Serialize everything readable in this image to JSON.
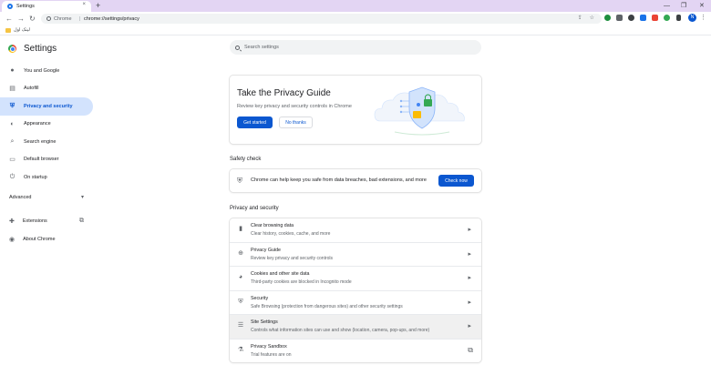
{
  "browser": {
    "tab_title": "Settings",
    "tab_close": "×",
    "new_tab": "+",
    "omnibox_site": "Chrome",
    "omnibox_url": "chrome://settings/privacy",
    "bookmark_folder": "لینک اول",
    "profile_initial": "N",
    "back": "←",
    "forward": "→",
    "reload": "↻",
    "menu": "⋮"
  },
  "sidebar": {
    "title": "Settings",
    "items": [
      {
        "label": "You and Google",
        "icon": "person-icon",
        "glyph": "👤"
      },
      {
        "label": "Autofill",
        "icon": "autofill-icon",
        "glyph": "▤"
      },
      {
        "label": "Privacy and security",
        "icon": "shield-icon",
        "glyph": "⛨"
      },
      {
        "label": "Appearance",
        "icon": "palette-icon",
        "glyph": "◐"
      },
      {
        "label": "Search engine",
        "icon": "search-icon",
        "glyph": "⌕"
      },
      {
        "label": "Default browser",
        "icon": "browser-icon",
        "glyph": "▭"
      },
      {
        "label": "On startup",
        "icon": "power-icon",
        "glyph": "⏻"
      }
    ],
    "advanced": "Advanced",
    "extensions": "Extensions",
    "about": "About Chrome"
  },
  "search": {
    "placeholder": "Search settings"
  },
  "privacy_guide_card": {
    "title": "Take the Privacy Guide",
    "description": "Review key privacy and security controls in Chrome",
    "primary_button": "Get started",
    "secondary_button": "No thanks"
  },
  "safety_check": {
    "heading": "Safety check",
    "text": "Chrome can help keep you safe from data breaches, bad extensions, and more",
    "button": "Check now"
  },
  "privacy_security": {
    "heading": "Privacy and security",
    "rows": [
      {
        "title": "Clear browsing data",
        "desc": "Clear history, cookies, cache, and more",
        "icon": "trash-icon",
        "glyph": "🗑"
      },
      {
        "title": "Privacy Guide",
        "desc": "Review key privacy and security controls",
        "icon": "compass-icon",
        "glyph": "⊕"
      },
      {
        "title": "Cookies and other site data",
        "desc": "Third-party cookies are blocked in Incognito mode",
        "icon": "cookie-icon",
        "glyph": "◕"
      },
      {
        "title": "Security",
        "desc": "Safe Browsing (protection from dangerous sites) and other security settings",
        "icon": "security-shield-icon",
        "glyph": "⛨"
      },
      {
        "title": "Site Settings",
        "desc": "Controls what information sites can use and show (location, camera, pop-ups, and more)",
        "icon": "sliders-icon",
        "glyph": "☰"
      },
      {
        "title": "Privacy Sandbox",
        "desc": "Trial features are on",
        "icon": "flask-icon",
        "glyph": "⚗"
      }
    ]
  },
  "colors": {
    "accent": "#0b57d0",
    "active_nav_bg": "#d3e3fd",
    "tabstrip": "#e3d5f3"
  }
}
